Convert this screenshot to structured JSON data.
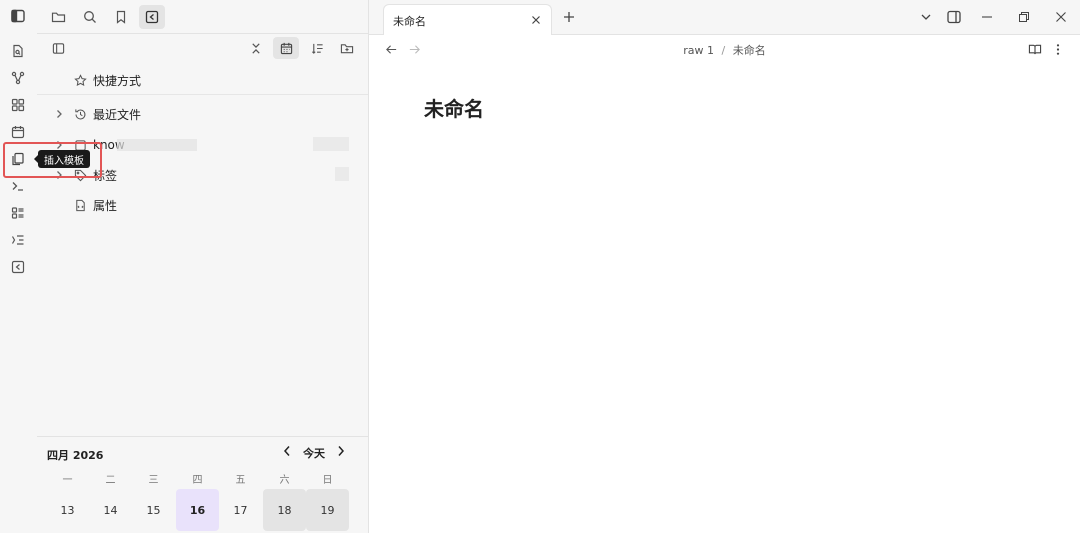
{
  "sidebar_tree": {
    "items": [
      {
        "label": "快捷方式"
      },
      {
        "label": "最近文件"
      },
      {
        "label": "know"
      },
      {
        "label": "标签"
      },
      {
        "label": "属性"
      }
    ]
  },
  "tooltip": {
    "text": "插入模板"
  },
  "calendar": {
    "month_label": "四月 2026",
    "today_label": "今天",
    "weekdays": [
      "一",
      "二",
      "三",
      "四",
      "五",
      "六",
      "日"
    ],
    "days": [
      "13",
      "14",
      "15",
      "16",
      "17",
      "18",
      "19"
    ],
    "today_day": "16"
  },
  "tabs": [
    {
      "label": "未命名"
    }
  ],
  "breadcrumb": {
    "folder": "raw 1",
    "separator": "/",
    "file": "未命名"
  },
  "note": {
    "title": "未命名"
  },
  "colors": {
    "accent_today": "#e9e2fb",
    "highlight": "#e25555"
  }
}
